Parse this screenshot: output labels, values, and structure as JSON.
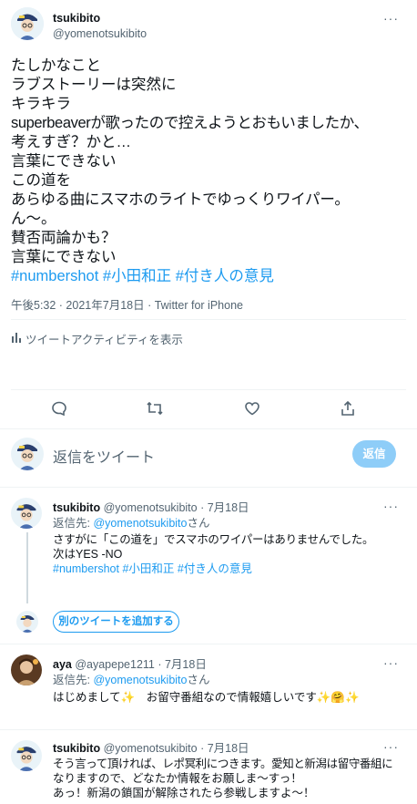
{
  "main_tweet": {
    "display_name": "tsukibito",
    "handle": "@yomenotsukibito",
    "more": "···",
    "lines": [
      "たしかなこと",
      "ラブストーリーは突然に",
      "キラキラ",
      "superbeaverが歌ったので控えようとおもいましたか、",
      "考えすぎ？かと…",
      "言葉にできない",
      "この道を",
      "あらゆる曲にスマホのライトでゆっくりワイパー。",
      "ん〜。",
      "賛否両論かも？",
      "言葉にできない"
    ],
    "hashtags": [
      "#numbershot",
      "#小田和正",
      "#付き人の意見"
    ],
    "timestamp": "午後5:32 · 2021年7月18日 · Twitter for iPhone",
    "activity_label": "ツイートアクティビティを表示"
  },
  "compose": {
    "placeholder": "返信をツイート",
    "button_label": "返信"
  },
  "replies": [
    {
      "display_name": "tsukibito",
      "meta": "@yomenotsukibito · 7月18日",
      "reply_to_prefix": "返信先: ",
      "reply_to_handle": "@yomenotsukibito",
      "reply_to_suffix": "さん",
      "lines": [
        "さすがに「この道を」でスマホのワイパーはありませんでした。",
        "次はYES -NO"
      ],
      "hashtags": [
        "#numbershot",
        "#小田和正",
        "#付き人の意見"
      ],
      "more": "···"
    },
    {
      "display_name": "aya",
      "meta": "@ayapepe1211 · 7月18日",
      "reply_to_prefix": "返信先: ",
      "reply_to_handle": "@yomenotsukibito",
      "reply_to_suffix": "さん",
      "lines": [
        "はじめまして✨　お留守番組なので情報嬉しいです✨🤗✨"
      ],
      "more": "···"
    },
    {
      "display_name": "tsukibito",
      "meta": "@yomenotsukibito · 7月18日",
      "lines": [
        "そう言って頂ければ、レポ冥利につきます。愛知と新潟は留守番組に",
        "なりますので、どなたか情報をお願しま〜すっ！",
        "あっ！新潟の鎖国が解除されたら参戦しますよ〜！"
      ],
      "more": "···"
    }
  ],
  "add_tweet_label": "別のツイートを追加する",
  "colors": {
    "accent": "#1d9bf0",
    "button_disabled": "#8ecdf8",
    "muted": "#536471"
  }
}
